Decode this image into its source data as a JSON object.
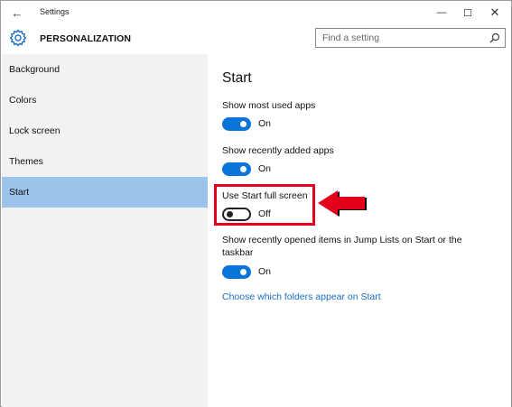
{
  "window": {
    "title": "Settings",
    "back_glyph": "←",
    "minimize_glyph": "—",
    "maximize_glyph": "☐",
    "close_glyph": "✕"
  },
  "header": {
    "section": "PERSONALIZATION",
    "search_placeholder": "Find a setting"
  },
  "sidebar": {
    "items": [
      {
        "label": "Background"
      },
      {
        "label": "Colors"
      },
      {
        "label": "Lock screen"
      },
      {
        "label": "Themes"
      },
      {
        "label": "Start",
        "selected": true
      }
    ]
  },
  "content": {
    "heading": "Start",
    "settings": [
      {
        "label": "Show most used apps",
        "state": "On"
      },
      {
        "label": "Show recently added apps",
        "state": "On"
      },
      {
        "label": "Use Start full screen",
        "state": "Off"
      },
      {
        "label_line1": "Show recently opened items in Jump Lists on Start or the",
        "label_line2": "taskbar",
        "state": "On"
      }
    ],
    "link": "Choose which folders appear on Start"
  },
  "colors": {
    "accent": "#0a74d8",
    "selection": "#9bc4ea",
    "annotation_red": "#e3001b",
    "link": "#1a6fc4"
  },
  "icons": [
    "back-arrow-icon",
    "gear-icon",
    "search-icon",
    "annotation-arrow-icon"
  ]
}
